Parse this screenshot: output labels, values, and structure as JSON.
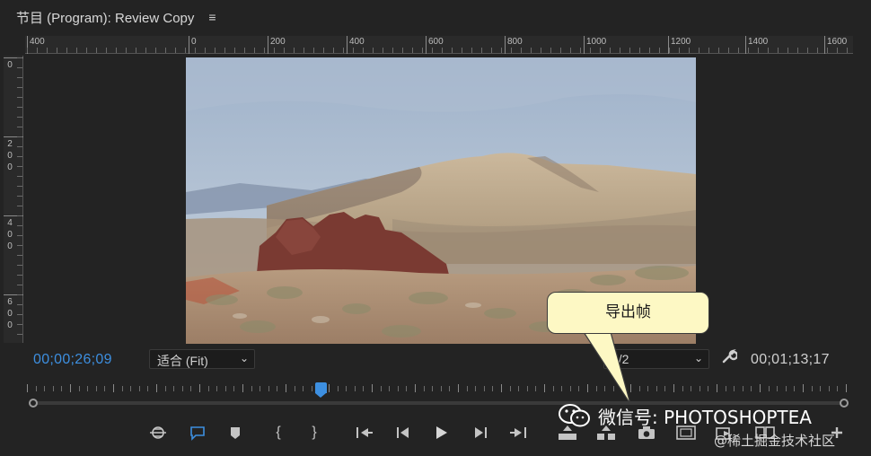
{
  "panel": {
    "title": "节目 (Program): Review Copy",
    "menu_icon": "hamburger-icon"
  },
  "ruler": {
    "horizontal_labels": [
      "400",
      "0",
      "200",
      "400",
      "600",
      "800",
      "1000",
      "1200",
      "1400",
      "1600"
    ],
    "vertical_labels": [
      "0",
      "200",
      "400",
      "600"
    ]
  },
  "viewer": {
    "image": "desert-landscape-red-rock"
  },
  "timecode": {
    "current": "00;00;26;09",
    "duration": "00;01;13;17"
  },
  "zoom_select": {
    "value": "适合 (Fit)"
  },
  "resolution_select": {
    "value": "1/2"
  },
  "playhead_fraction": 0.355,
  "callout": {
    "text": "导出帧"
  },
  "watermarks": {
    "wechat": "微信号: PHOTOSHOPTEA",
    "site": "@稀土掘金技术社区"
  },
  "controls": [
    {
      "name": "marker-edit-icon"
    },
    {
      "name": "comment-icon"
    },
    {
      "name": "add-marker-icon"
    },
    {
      "name": "mark-in-icon"
    },
    {
      "name": "mark-out-icon"
    },
    {
      "name": "go-to-in-icon"
    },
    {
      "name": "step-back-icon"
    },
    {
      "name": "play-icon"
    },
    {
      "name": "step-forward-icon"
    },
    {
      "name": "go-to-out-icon"
    },
    {
      "name": "lift-icon"
    },
    {
      "name": "extract-icon"
    },
    {
      "name": "export-frame-icon"
    },
    {
      "name": "safe-margins-icon"
    },
    {
      "name": "insert-icon"
    },
    {
      "name": "compare-view-icon"
    },
    {
      "name": "add-button-icon"
    }
  ],
  "colors": {
    "accent": "#3d8fe0",
    "background": "#232323",
    "callout": "#fdf8c4"
  }
}
